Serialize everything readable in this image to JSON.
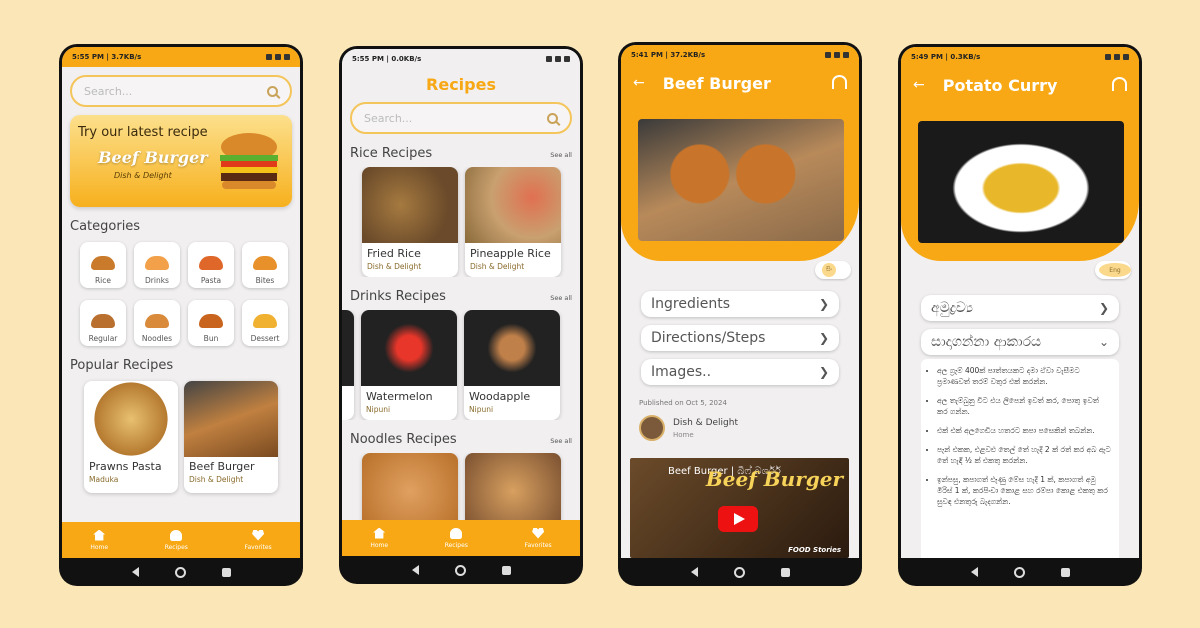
{
  "colors": {
    "accent": "#f7a814",
    "background": "#fbe6b8"
  },
  "phone1": {
    "status": {
      "time": "5:55 PM | 3.7KB/s"
    },
    "search": {
      "placeholder": "Search..."
    },
    "banner": {
      "line1": "Try our latest recipe",
      "line2": "Beef Burger",
      "line3": "Dish & Delight"
    },
    "categories_title": "Categories",
    "categories": [
      "Rice",
      "Drinks",
      "Pasta",
      "Bites",
      "Regular",
      "Noodles",
      "Bun",
      "Dessert"
    ],
    "popular_title": "Popular Recipes",
    "popular": [
      {
        "name": "Prawns Pasta",
        "by": "Maduka"
      },
      {
        "name": "Beef Burger",
        "by": "Dish & Delight"
      }
    ],
    "tabs": [
      "Home",
      "Recipes",
      "Favorites"
    ]
  },
  "phone2": {
    "status": {
      "time": "5:55 PM | 0.0KB/s"
    },
    "title": "Recipes",
    "search": {
      "placeholder": "Search..."
    },
    "see_all": "See all",
    "rice": {
      "title": "Rice Recipes",
      "items": [
        {
          "name": "Fried Rice",
          "by": "Dish & Delight"
        },
        {
          "name": "Pineapple Rice",
          "by": "Dish & Delight"
        }
      ]
    },
    "drinks": {
      "title": "Drinks Recipes",
      "items": [
        {
          "name": "Watermelon",
          "by": "Nipuni"
        },
        {
          "name": "Woodapple",
          "by": "Nipuni"
        }
      ]
    },
    "noodles": {
      "title": "Noodles Recipes"
    },
    "tabs": [
      "Home",
      "Recipes",
      "Favorites"
    ]
  },
  "phone3": {
    "status": {
      "time": "5:41 PM | 37.2KB/s"
    },
    "title": "Beef Burger",
    "toggle": "සිං",
    "sections": [
      "Ingredients",
      "Directions/Steps",
      "Images.."
    ],
    "published": "Published on Oct 5, 2024",
    "author": {
      "name": "Dish & Delight",
      "role": "Home"
    },
    "video": {
      "title": "Beef Burger | බීෆ් බර්ගර්",
      "overlay": "Beef Burger",
      "badge": "FOOD Stories"
    }
  },
  "phone4": {
    "status": {
      "time": "5:49 PM | 0.3KB/s"
    },
    "title": "Potato Curry",
    "toggle": "Eng",
    "sections": [
      "අමුද්‍රව්‍ය",
      "සාදාගන්නා ආකාරය"
    ],
    "steps": [
      "අල ග්‍රෑම් 400ක් පාත්තයකට දමා ඒවා වැසීමට ප්‍රමාණවත් තරම් වතුර එක් කරන්න.",
      "අල තැම්බුනු විට එය ලිපෙන් ඉවත් කර, පොතු ඉවත් කර ගන්න.",
      "එක් එක් අලගෙඩිය හතරට කපා පසෙකින් තබන්න.",
      "පෑන් එකක, එළවළු තෙල් තේ හැදි 2 ක් රත් කර අබ ඇට තේ හැඳි ½ ක් එකතු කරන්න.",
      "ඉන්පසු, කපාගත් ළූණු මේස හැදි 1 ක්, කපාගත් අමු මිරිස් 1 ක්, කරපිංචා කොළ සහ රම්පා කොළ එකතු කර සුවඳ එනතුරු බැදගන්න."
    ]
  }
}
